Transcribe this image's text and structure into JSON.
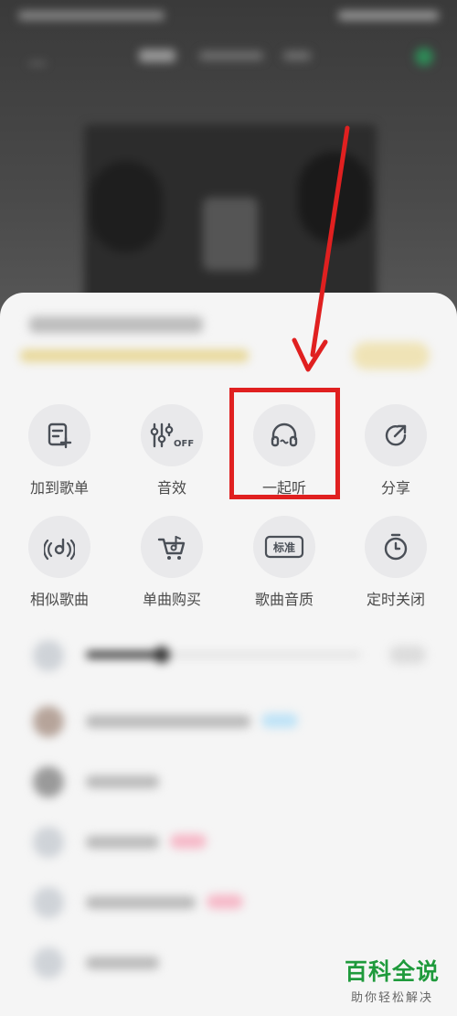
{
  "share_sheet": {
    "actions": [
      {
        "label": "加到歌单",
        "icon": "add-to-playlist-icon"
      },
      {
        "label": "音效",
        "icon": "sound-effect-equalizer-icon",
        "icon_text": "OFF"
      },
      {
        "label": "一起听",
        "icon": "listen-together-headphones-icon"
      },
      {
        "label": "分享",
        "icon": "share-icon"
      },
      {
        "label": "相似歌曲",
        "icon": "similar-songs-icon"
      },
      {
        "label": "单曲购买",
        "icon": "buy-song-cart-icon"
      },
      {
        "label": "歌曲音质",
        "icon": "sound-quality-icon",
        "icon_text": "标准"
      },
      {
        "label": "定时关闭",
        "icon": "sleep-timer-icon"
      }
    ],
    "highlighted_action": "一起听"
  },
  "colors": {
    "annotation_red": "#e02020",
    "icon_stroke": "#4a4f57",
    "watermark_green": "#1f9a3c"
  },
  "watermark": {
    "main": "百科全说",
    "sub": "助你轻松解决"
  }
}
